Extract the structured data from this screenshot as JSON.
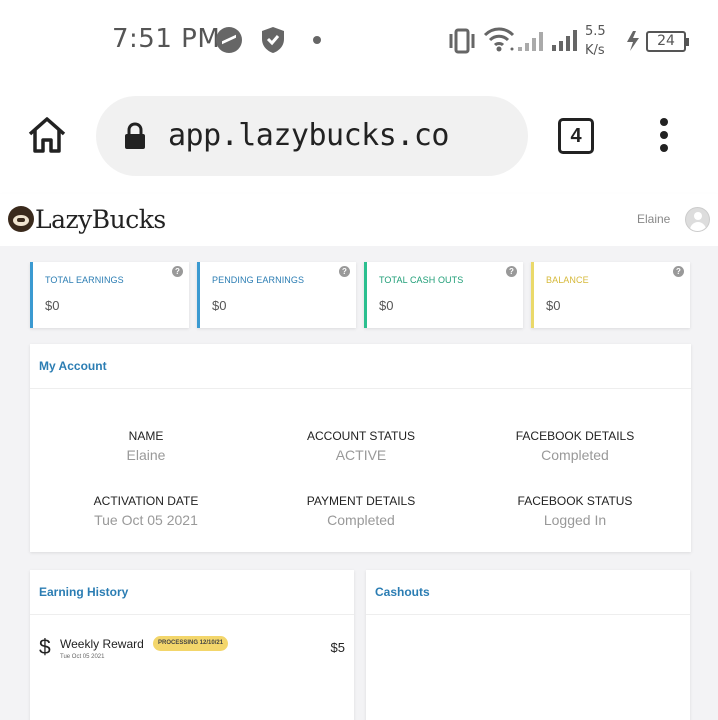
{
  "status_bar": {
    "time": "7:51 PM",
    "speed_value": "5.5",
    "speed_unit": "K/s",
    "battery": "24",
    "icons": [
      "messenger-icon",
      "shield-icon",
      "dot-icon",
      "vibrate-icon",
      "wifi-icon",
      "signal-icon",
      "charging-icon",
      "battery-icon"
    ]
  },
  "browser": {
    "url": "app.lazybucks.co",
    "tab_count": "4",
    "icons": [
      "home-icon",
      "lock-icon",
      "more-menu-icon"
    ]
  },
  "app": {
    "brand": "LazyBucks",
    "user_name": "Elaine"
  },
  "stats": [
    {
      "label": "TOTAL EARNINGS",
      "value": "$0",
      "color": "#3b9ad1"
    },
    {
      "label": "PENDING EARNINGS",
      "value": "$0",
      "color": "#3b9ad1"
    },
    {
      "label": "TOTAL CASH OUTS",
      "value": "$0",
      "color": "#2bbf8f"
    },
    {
      "label": "BALANCE",
      "value": "$0",
      "color": "#ead96a"
    }
  ],
  "help_glyph": "?",
  "account": {
    "title": "My Account",
    "fields": [
      {
        "key": "NAME",
        "value": "Elaine"
      },
      {
        "key": "ACCOUNT STATUS",
        "value": "ACTIVE"
      },
      {
        "key": "FACEBOOK DETAILS",
        "value": "Completed"
      },
      {
        "key": "ACTIVATION DATE",
        "value": "Tue Oct 05 2021"
      },
      {
        "key": "PAYMENT DETAILS",
        "value": "Completed"
      },
      {
        "key": "FACEBOOK STATUS",
        "value": "Logged In"
      }
    ]
  },
  "earning_history": {
    "title": "Earning History",
    "items": [
      {
        "title": "Weekly Reward",
        "date": "Tue Oct 05 2021",
        "badge": "PROCESSING 12/10/21",
        "amount": "$5"
      }
    ]
  },
  "cashouts": {
    "title": "Cashouts"
  },
  "colors": {
    "accent_blue": "#2b7db3",
    "badge_yellow": "#f3d66b"
  }
}
